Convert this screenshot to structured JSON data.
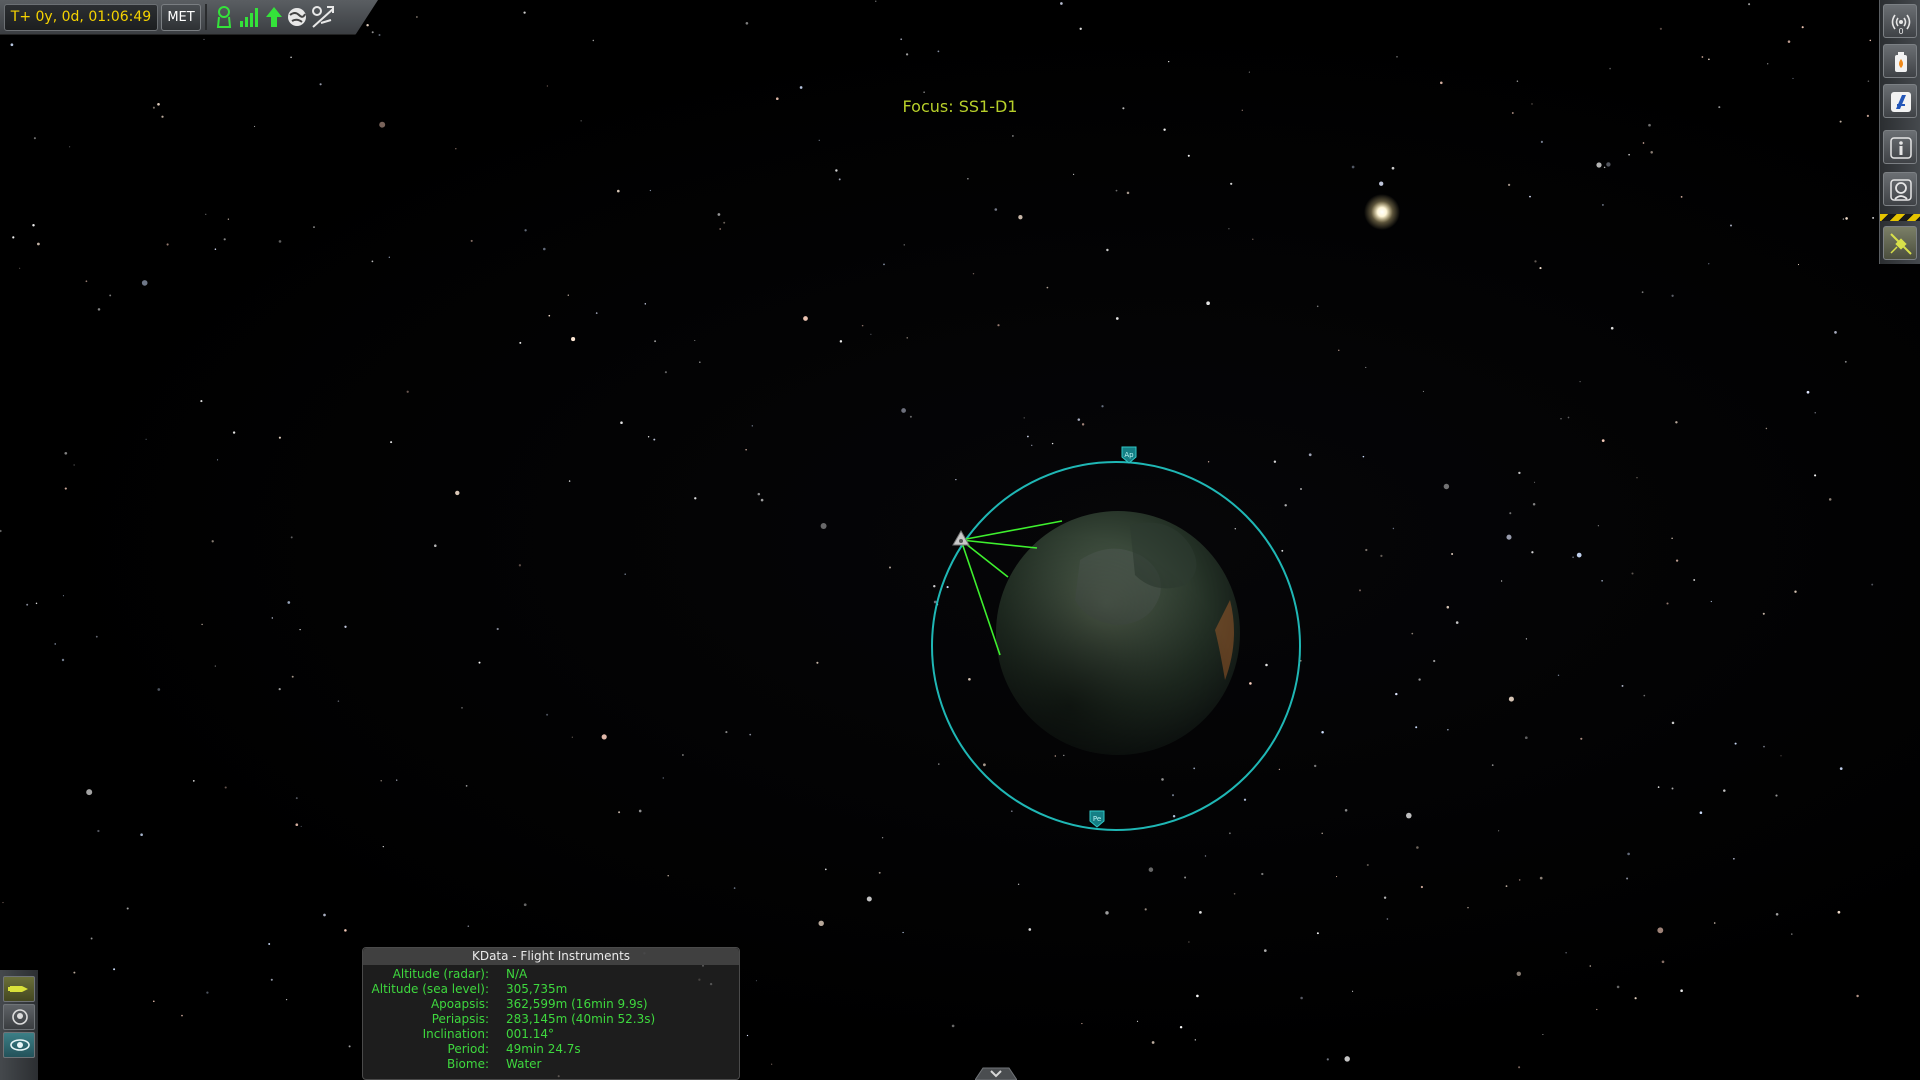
{
  "hud": {
    "met_time": "T+ 0y, 0d, 01:06:49",
    "met_mode": "MET",
    "status_icons": [
      "crew-icon",
      "signal-strength-icon",
      "up-arrow-icon",
      "globe-icon",
      "tracking-icon"
    ]
  },
  "focus": {
    "label": "Focus: SS1-D1"
  },
  "right_toolbar": {
    "buttons": [
      "antenna-icon",
      "fuel-icon",
      "kerbalism-icon",
      "info-icon",
      "astronaut-icon",
      "satellite-icon"
    ],
    "signal_count": "0"
  },
  "left_toolbar": {
    "buttons": [
      "vessel-icon",
      "crew-portrait-icon",
      "map-view-icon"
    ]
  },
  "kdata": {
    "title": "KData - Flight Instruments",
    "rows": [
      {
        "label": "Altitude (radar):",
        "value": "N/A"
      },
      {
        "label": "Altitude (sea level):",
        "value": "305,735m"
      },
      {
        "label": "Apoapsis:",
        "value": "362,599m (16min 9.9s)"
      },
      {
        "label": "Periapsis:",
        "value": "283,145m (40min 52.3s)"
      },
      {
        "label": "Inclination:",
        "value": "001.14°"
      },
      {
        "label": "Period:",
        "value": "49min 24.7s"
      },
      {
        "label": "Biome:",
        "value": "Water"
      }
    ]
  },
  "map": {
    "orbit_color": "#1fb7b5",
    "link_color": "#3ef02e",
    "markers": [
      "apoapsis-marker",
      "periapsis-marker"
    ]
  }
}
